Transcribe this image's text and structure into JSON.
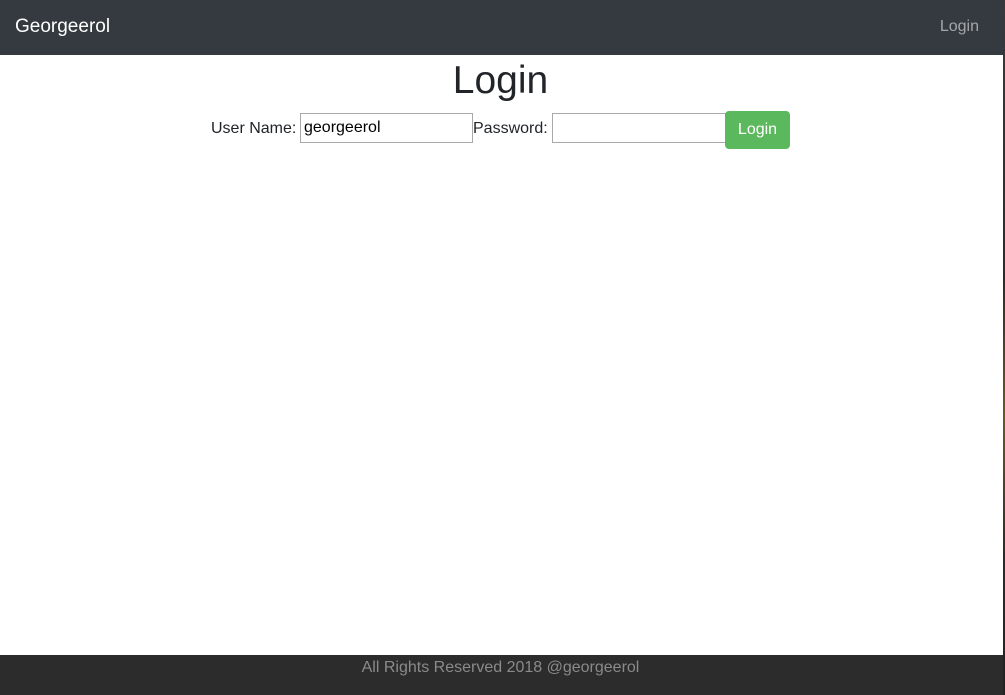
{
  "navbar": {
    "brand": "Georgeerol",
    "login_link": "Login"
  },
  "main": {
    "title": "Login",
    "form": {
      "username_label": "User Name:",
      "username_value": "georgeerol",
      "password_label": "Password:",
      "password_value": "",
      "submit_label": "Login"
    }
  },
  "footer": {
    "text": "All Rights Reserved 2018 @georgeerol"
  },
  "colors": {
    "navbar_bg": "#343a40",
    "button_bg": "#5cb85c",
    "footer_bg": "#2c2c2c"
  }
}
